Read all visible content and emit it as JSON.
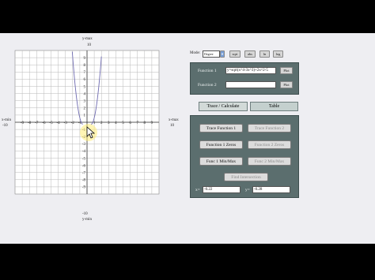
{
  "graph": {
    "ymax_label": "y-max",
    "ymin_label": "y-min",
    "xmin_label": "x-min",
    "xmax_label": "x-max",
    "ymax_value": "10",
    "ymin_value": "-10",
    "xmin_value": "-10",
    "xmax_value": "10",
    "x_ticks": [
      "-9",
      "-8",
      "-7",
      "-6",
      "-5",
      "-4",
      "-3",
      "-2",
      "-1",
      "1",
      "2",
      "3",
      "4",
      "5",
      "6",
      "7",
      "8",
      "9"
    ],
    "y_ticks": [
      "9",
      "8",
      "7",
      "6",
      "5",
      "4",
      "3",
      "2",
      "1",
      "-1",
      "-2",
      "-3",
      "-4",
      "-5",
      "-6",
      "-7",
      "-8",
      "-9"
    ],
    "curve_color": "#6e6ab0",
    "grid_color": "#b8b8b8"
  },
  "mode": {
    "label": "Mode:",
    "select_value": "Degree",
    "buttons": [
      "sqrt",
      "abs",
      "ln",
      "log"
    ]
  },
  "functions": {
    "f1_label": "Function 1",
    "f1_value": "y=sqrt(x^4-3x^3)+2x^2-5",
    "f2_label": "Function 2",
    "f2_value": "",
    "plot_label": "Plot"
  },
  "tabs": {
    "trace": "Trace / Calculate",
    "table": "Table"
  },
  "calc": {
    "trace1": "Trace Function 1",
    "trace2": "Trace Function 2",
    "zeros1": "Function 1 Zeros",
    "zeros2": "Function 2 Zeros",
    "minmax1": "Func 1 Min/Max",
    "minmax2": "Func 2 Min/Max",
    "intersection": "Find Intersection",
    "x_label": "x=",
    "x_value": "-0.22",
    "y_label": "y=",
    "y_value": "-0.28"
  },
  "colors": {
    "panel": "#5b6e6e",
    "background": "#eeeef2"
  }
}
